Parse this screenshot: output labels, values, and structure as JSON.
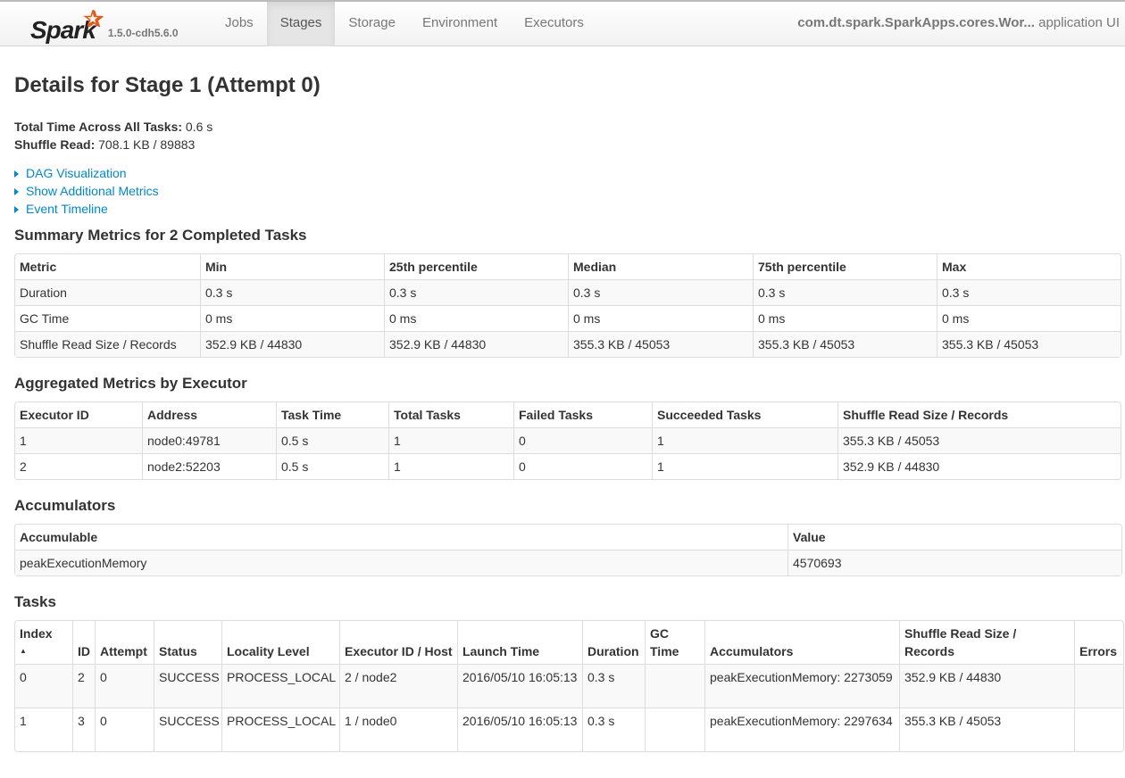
{
  "nav": {
    "version": "1.5.0-cdh5.6.0",
    "logo": "Spark",
    "tabs": [
      "Jobs",
      "Stages",
      "Storage",
      "Environment",
      "Executors"
    ],
    "active": "Stages",
    "app_name": "com.dt.spark.SparkApps.cores.Wor...",
    "app_suffix": "application UI"
  },
  "page": {
    "title": "Details for Stage 1 (Attempt 0)",
    "total_time_label": "Total Time Across All Tasks:",
    "total_time": "0.6 s",
    "shuffle_read_label": "Shuffle Read:",
    "shuffle_read": "708.1 KB / 89883",
    "links": [
      "DAG Visualization",
      "Show Additional Metrics",
      "Event Timeline"
    ]
  },
  "summary": {
    "title": "Summary Metrics for 2 Completed Tasks",
    "headers": [
      "Metric",
      "Min",
      "25th percentile",
      "Median",
      "75th percentile",
      "Max"
    ],
    "rows": [
      [
        "Duration",
        "0.3 s",
        "0.3 s",
        "0.3 s",
        "0.3 s",
        "0.3 s"
      ],
      [
        "GC Time",
        "0 ms",
        "0 ms",
        "0 ms",
        "0 ms",
        "0 ms"
      ],
      [
        "Shuffle Read Size / Records",
        "352.9 KB / 44830",
        "352.9 KB / 44830",
        "355.3 KB / 45053",
        "355.3 KB / 45053",
        "355.3 KB / 45053"
      ]
    ]
  },
  "executors": {
    "title": "Aggregated Metrics by Executor",
    "headers": [
      "Executor ID",
      "Address",
      "Task Time",
      "Total Tasks",
      "Failed Tasks",
      "Succeeded Tasks",
      "Shuffle Read Size / Records"
    ],
    "rows": [
      [
        "1",
        "node0:49781",
        "0.5 s",
        "1",
        "0",
        "1",
        "355.3 KB / 45053"
      ],
      [
        "2",
        "node2:52203",
        "0.5 s",
        "1",
        "0",
        "1",
        "352.9 KB / 44830"
      ]
    ]
  },
  "accumulators": {
    "title": "Accumulators",
    "headers": [
      "Accumulable",
      "Value"
    ],
    "rows": [
      [
        "peakExecutionMemory",
        "4570693"
      ]
    ]
  },
  "tasks": {
    "title": "Tasks",
    "sort_icon": "sort-ascending-icon",
    "headers": [
      "Index",
      "ID",
      "Attempt",
      "Status",
      "Locality Level",
      "Executor ID / Host",
      "Launch Time",
      "Duration",
      "GC Time",
      "Accumulators",
      "Shuffle Read Size / Records",
      "Errors"
    ],
    "rows": [
      [
        "0",
        "2",
        "0",
        "SUCCESS",
        "PROCESS_LOCAL",
        "2 / node2",
        "2016/05/10 16:05:13",
        "0.3 s",
        "",
        "peakExecutionMemory: 2273059",
        "352.9 KB / 44830",
        ""
      ],
      [
        "1",
        "3",
        "0",
        "SUCCESS",
        "PROCESS_LOCAL",
        "1 / node0",
        "2016/05/10 16:05:13",
        "0.3 s",
        "",
        "peakExecutionMemory: 2297634",
        "355.3 KB / 45053",
        ""
      ]
    ]
  }
}
